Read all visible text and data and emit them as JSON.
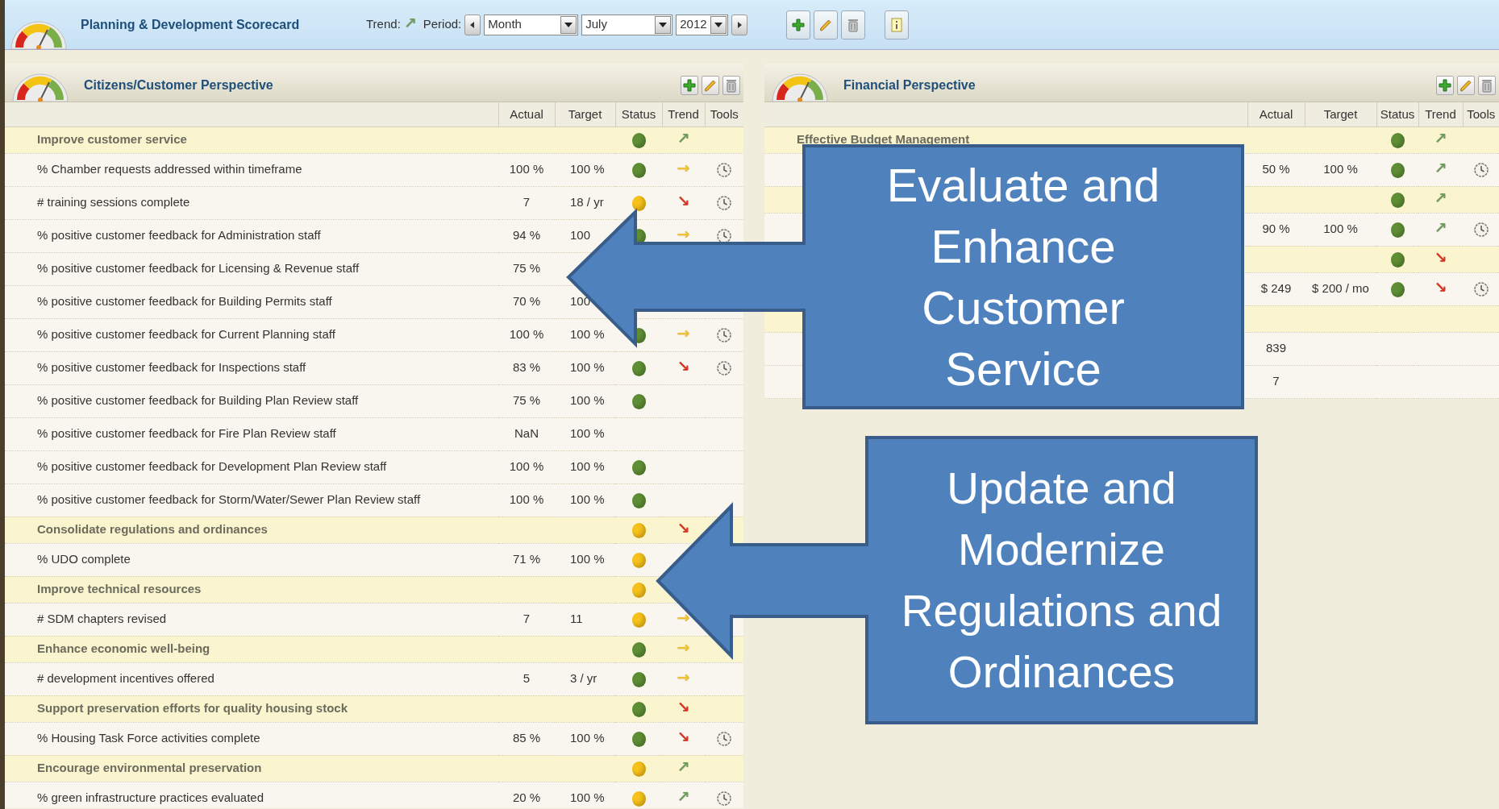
{
  "toolbar": {
    "title": "Planning & Development Scorecard",
    "trend_label": "Trend:",
    "trend": {
      "glyph": "↗",
      "color": "#6e9c5c"
    },
    "period_label": "Period:",
    "period": "Month",
    "month": "July",
    "year": "2012"
  },
  "panels": [
    {
      "title": "Citizens/Customer Perspective",
      "columns": [
        "Actual",
        "Target",
        "Status",
        "Trend",
        "Tools"
      ],
      "rows": [
        {
          "kind": "group",
          "label": "Improve customer service",
          "status": {
            "color": "#5f8f35"
          },
          "trend": {
            "glyph": "↗",
            "color": "#6e9c5c"
          }
        },
        {
          "kind": "metric",
          "label": "% Chamber requests addressed within timeframe",
          "actual": "100 %",
          "target": "100 %",
          "status": {
            "color": "#5f8f35"
          },
          "trend": {
            "glyph": "→",
            "color": "#f2c12e"
          },
          "tools": true
        },
        {
          "kind": "metric",
          "label": "# training sessions complete",
          "actual": "7",
          "target": "18 / yr",
          "status": {
            "color": "#f6c21a"
          },
          "trend": {
            "glyph": "↘",
            "color": "#d9331f"
          },
          "tools": true
        },
        {
          "kind": "metric",
          "label": "% positive customer feedback for Administration staff",
          "actual": "94 %",
          "target": "100",
          "status": {
            "color": "#5f8f35"
          },
          "trend": {
            "glyph": "→",
            "color": "#f2c12e"
          },
          "tools": true
        },
        {
          "kind": "metric",
          "label": "% positive customer feedback for Licensing & Revenue staff",
          "actual": "75 %"
        },
        {
          "kind": "metric",
          "label": "% positive customer feedback for Building Permits staff",
          "actual": "70 %",
          "target": "100"
        },
        {
          "kind": "metric",
          "label": "% positive customer feedback for Current Planning staff",
          "actual": "100 %",
          "target": "100 %",
          "status": {
            "color": "#5f8f35"
          },
          "trend": {
            "glyph": "→",
            "color": "#f2c12e"
          },
          "tools": true
        },
        {
          "kind": "metric",
          "label": "% positive customer feedback for Inspections staff",
          "actual": "83 %",
          "target": "100 %",
          "status": {
            "color": "#5f8f35"
          },
          "trend": {
            "glyph": "↘",
            "color": "#d9331f"
          },
          "tools": true
        },
        {
          "kind": "metric",
          "label": "% positive customer feedback for Building Plan Review staff",
          "actual": "75 %",
          "target": "100 %",
          "status": {
            "color": "#5f8f35"
          }
        },
        {
          "kind": "metric",
          "label": "% positive customer feedback for Fire Plan Review staff",
          "actual": "NaN",
          "target": "100 %"
        },
        {
          "kind": "metric",
          "label": "% positive customer feedback for Development Plan Review staff",
          "actual": "100 %",
          "target": "100 %",
          "status": {
            "color": "#5f8f35"
          }
        },
        {
          "kind": "metric",
          "label": "% positive customer feedback for Storm/Water/Sewer Plan Review staff",
          "actual": "100 %",
          "target": "100 %",
          "status": {
            "color": "#5f8f35"
          }
        },
        {
          "kind": "group",
          "label": "Consolidate regulations and ordinances",
          "status": {
            "color": "#f6c21a"
          },
          "trend": {
            "glyph": "↘",
            "color": "#d9331f"
          }
        },
        {
          "kind": "metric",
          "label": "% UDO complete",
          "actual": "71 %",
          "target": "100 %",
          "status": {
            "color": "#f6c21a"
          }
        },
        {
          "kind": "group",
          "label": "Improve technical resources",
          "status": {
            "color": "#f6c21a"
          }
        },
        {
          "kind": "metric",
          "label": "# SDM chapters revised",
          "actual": "7",
          "target": "11",
          "status": {
            "color": "#f6c21a"
          },
          "trend": {
            "glyph": "→",
            "color": "#f2c12e"
          }
        },
        {
          "kind": "group",
          "label": "Enhance economic well-being",
          "status": {
            "color": "#5f8f35"
          },
          "trend": {
            "glyph": "→",
            "color": "#f2c12e"
          }
        },
        {
          "kind": "metric",
          "label": "# development incentives offered",
          "actual": "5",
          "target": "3 / yr",
          "status": {
            "color": "#5f8f35"
          },
          "trend": {
            "glyph": "→",
            "color": "#f2c12e"
          }
        },
        {
          "kind": "group",
          "label": "Support preservation efforts for quality housing stock",
          "status": {
            "color": "#5f8f35"
          },
          "trend": {
            "glyph": "↘",
            "color": "#d9331f"
          }
        },
        {
          "kind": "metric",
          "label": "% Housing Task Force activities complete",
          "actual": "85 %",
          "target": "100 %",
          "status": {
            "color": "#5f8f35"
          },
          "trend": {
            "glyph": "↘",
            "color": "#d9331f"
          },
          "tools": true
        },
        {
          "kind": "group",
          "label": "Encourage environmental preservation",
          "status": {
            "color": "#f6c21a"
          },
          "trend": {
            "glyph": "↗",
            "color": "#6e9c5c"
          }
        },
        {
          "kind": "metric",
          "label": "% green infrastructure practices evaluated",
          "actual": "20 %",
          "target": "100 %",
          "status": {
            "color": "#f6c21a"
          },
          "trend": {
            "glyph": "↗",
            "color": "#6e9c5c"
          },
          "tools": true
        }
      ]
    },
    {
      "title": "Financial Perspective",
      "columns": [
        "Actual",
        "Target",
        "Status",
        "Trend",
        "Tools"
      ],
      "rows": [
        {
          "kind": "group",
          "label": "Effective Budget Management",
          "status": {
            "color": "#5f8f35"
          },
          "trend": {
            "glyph": "↗",
            "color": "#6e9c5c"
          }
        },
        {
          "kind": "metric",
          "actual": "50 %",
          "target": "100 %",
          "status": {
            "color": "#5f8f35"
          },
          "trend": {
            "glyph": "↗",
            "color": "#6e9c5c"
          },
          "tools": true
        },
        {
          "kind": "group",
          "status": {
            "color": "#5f8f35"
          },
          "trend": {
            "glyph": "↗",
            "color": "#6e9c5c"
          }
        },
        {
          "kind": "metric",
          "actual": "90 %",
          "target": "100 %",
          "status": {
            "color": "#5f8f35"
          },
          "trend": {
            "glyph": "↗",
            "color": "#6e9c5c"
          },
          "tools": true
        },
        {
          "kind": "group",
          "status": {
            "color": "#5f8f35"
          },
          "trend": {
            "glyph": "↘",
            "color": "#d9331f"
          }
        },
        {
          "kind": "metric",
          "actual": "$ 249",
          "target": "$ 200 / mo",
          "status": {
            "color": "#5f8f35"
          },
          "trend": {
            "glyph": "↘",
            "color": "#d9331f"
          },
          "tools": true
        },
        {
          "kind": "group"
        },
        {
          "kind": "metric",
          "actual": "839"
        },
        {
          "kind": "metric",
          "actual": "7"
        }
      ]
    }
  ],
  "callouts": [
    {
      "text": "Evaluate and Enhance Customer Service"
    },
    {
      "text": "Update and Modernize Regulations and Ordinances"
    }
  ]
}
